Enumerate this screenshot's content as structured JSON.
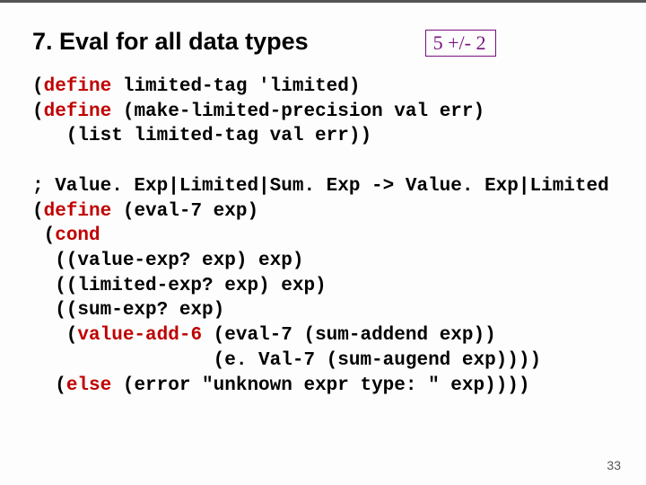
{
  "title": "7. Eval for all data types",
  "badge": "5 +/- 2",
  "kw": {
    "define": "define",
    "cond": "cond",
    "else": "else",
    "valueadd6": "value-add-6"
  },
  "code": {
    "l1a": "(",
    "l1b": " limited-tag 'limited)",
    "l2a": "(",
    "l2b": " (make-limited-precision val err)",
    "l3": "   (list limited-tag val err))",
    "blank1": "",
    "l4": "; Value. Exp|Limited|Sum. Exp -> Value. Exp|Limited",
    "l5a": "(",
    "l5b": " (eval-7 exp)",
    "l6a": " (",
    "l7": "  ((value-exp? exp) exp)",
    "l8": "  ((limited-exp? exp) exp)",
    "l9": "  ((sum-exp? exp)",
    "l10a": "   (",
    "l10b": " (eval-7 (sum-addend exp))",
    "l11": "                (e. Val-7 (sum-augend exp))))",
    "l12a": "  (",
    "l12b": " (error \"unknown expr type: \" exp))))"
  },
  "page": "33"
}
